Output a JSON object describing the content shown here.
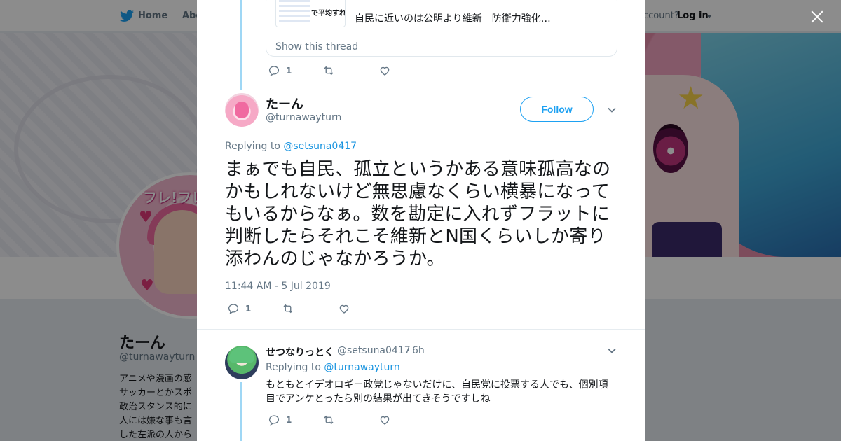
{
  "nav": {
    "home_label": "Home",
    "about_label": "Abo",
    "account_prompt": "ccount?",
    "login_label": "Log in"
  },
  "background_profile": {
    "name": "たーん",
    "handle": "@turnawayturn",
    "avatar_text": "フレ!フレ!",
    "bio_lines": [
      "アニメや漫画の感",
      "サッカーとかスポ",
      "政治スタンス的に",
      "人には嫌な事も言",
      "した左派の人から"
    ]
  },
  "modal": {
    "close_icon": "close-icon",
    "previous_tweet": {
      "quote_image_text": "で平均すれ",
      "quote_snippet": "自民に近いのは公明より維新　防衛力強化…",
      "show_thread_label": "Show this thread",
      "reply_count": "1"
    },
    "main_tweet": {
      "author_name": "たーん",
      "author_handle": "@turnawayturn",
      "follow_label": "Follow",
      "replying_prefix": "Replying to",
      "replying_to": "@setsuna0417",
      "text": "まぁでも自民、孤立というかある意味孤高なのかもしれないけど無思慮なくらい横暴になってもいるからなぁ。数を勘定に入れずフラットに判断したらそれこそ維新とN国くらいしか寄り添わんのじゃなかろうか。",
      "timestamp": "11:44 AM - 5 Jul 2019",
      "reply_count": "1"
    },
    "reply_tweet": {
      "author_name": "せつなりっとく",
      "author_handle": "@setsuna0417",
      "separator": "·",
      "time": "6h",
      "replying_prefix": "Replying to",
      "replying_to": "@turnawayturn",
      "text": "もともとイデオロギー政党じゃないだけに、自民党に投票する人でも、個別項目でアンケとったら別の結果が出てきそうですしね",
      "reply_count": "1"
    }
  },
  "colors": {
    "accent": "#1da1f2",
    "link": "#1b95e0",
    "muted": "#657786",
    "thread_line": "#9fd7f5"
  }
}
